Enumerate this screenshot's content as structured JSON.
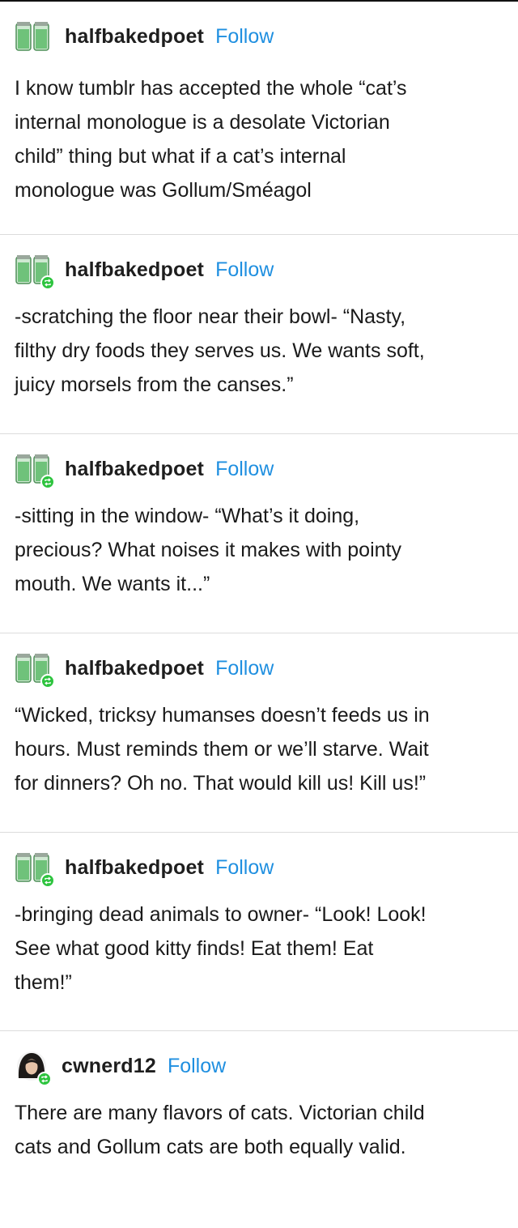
{
  "posts": [
    {
      "username": "halfbakedpoet",
      "follow_label": "Follow",
      "avatar": "glass-jar-avatar",
      "reblog_badge": false,
      "text": "I know tumblr has accepted the whole “cat’s\ninternal monologue is a desolate Victorian\nchild” thing but what if a cat’s internal\nmonologue was Gollum/Sméagol"
    },
    {
      "username": "halfbakedpoet",
      "follow_label": "Follow",
      "avatar": "glass-jar-avatar",
      "reblog_badge": true,
      "text": "-scratching the floor near their bowl- “Nasty,\nfilthy dry foods they serves us. We wants soft,\njuicy morsels from the canses.”"
    },
    {
      "username": "halfbakedpoet",
      "follow_label": "Follow",
      "avatar": "glass-jar-avatar",
      "reblog_badge": true,
      "text": "-sitting in the window- “What’s it doing,\nprecious? What noises it makes with pointy\nmouth. We wants it...”"
    },
    {
      "username": "halfbakedpoet",
      "follow_label": "Follow",
      "avatar": "glass-jar-avatar",
      "reblog_badge": true,
      "text": "“Wicked, tricksy humanses doesn’t feeds us in\nhours. Must reminds them or we’ll starve. Wait\nfor dinners? Oh no. That would kill us! Kill us!”"
    },
    {
      "username": "halfbakedpoet",
      "follow_label": "Follow",
      "avatar": "glass-jar-avatar",
      "reblog_badge": true,
      "text": "-bringing dead animals to owner- “Look! Look!\nSee what good kitty finds! Eat them! Eat\nthem!”"
    },
    {
      "username": "cwnerd12",
      "follow_label": "Follow",
      "avatar": "dark-hair-person-avatar",
      "reblog_badge": true,
      "text": "There are many flavors of cats. Victorian child\ncats and Gollum cats are both equally valid."
    }
  ],
  "colors": {
    "follow": "#1f8fe0",
    "reblog_badge": "#2ec43f",
    "jar_green": "#6fc27a",
    "divider": "#dcdcdc"
  }
}
